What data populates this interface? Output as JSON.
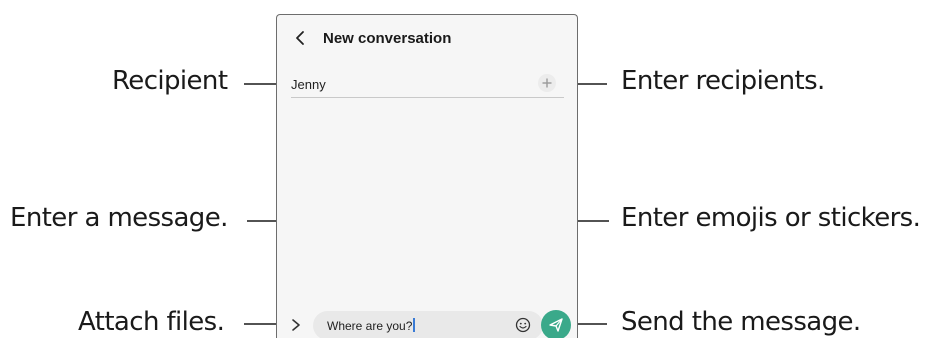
{
  "phone": {
    "title": "New conversation",
    "recipient_value": "Jenny",
    "message_value": "Where are you?",
    "accent_color": "#3aa98a"
  },
  "icons": {
    "back": "chevron-left-icon",
    "add_recipient": "plus-icon",
    "attach": "chevron-right-icon",
    "emoji": "smiley-icon",
    "send": "paper-plane-icon"
  },
  "callouts": {
    "recipient": "Recipient",
    "enter_recipients": "Enter recipients.",
    "enter_message": "Enter a message.",
    "enter_emojis": "Enter emojis or stickers.",
    "attach_files": "Attach files.",
    "send_message": "Send the message."
  }
}
